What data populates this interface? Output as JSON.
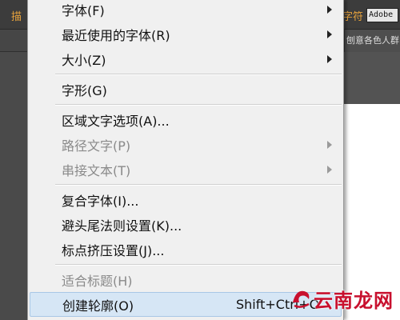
{
  "toolbar": {
    "left_text": "描",
    "right_text": "字符",
    "font_value": "Adobe"
  },
  "document_tab": "刨意各色人群",
  "menu": {
    "items": [
      {
        "label": "字体(F)",
        "submenu": true,
        "disabled": false
      },
      {
        "label": "最近使用的字体(R)",
        "submenu": true,
        "disabled": false
      },
      {
        "label": "大小(Z)",
        "submenu": true,
        "disabled": false
      },
      {
        "label": "字形(G)",
        "submenu": false,
        "disabled": false
      },
      {
        "label": "区域文字选项(A)...",
        "submenu": false,
        "disabled": false
      },
      {
        "label": "路径文字(P)",
        "submenu": true,
        "disabled": true
      },
      {
        "label": "串接文本(T)",
        "submenu": true,
        "disabled": true
      },
      {
        "label": "复合字体(I)...",
        "submenu": false,
        "disabled": false
      },
      {
        "label": "避头尾法则设置(K)...",
        "submenu": false,
        "disabled": false
      },
      {
        "label": "标点挤压设置(J)...",
        "submenu": false,
        "disabled": false
      },
      {
        "label": "适合标题(H)",
        "submenu": false,
        "disabled": true
      },
      {
        "label": "创建轮廓(O)",
        "shortcut": "Shift+Ctrl+O",
        "submenu": false,
        "disabled": false,
        "highlighted": true
      }
    ]
  },
  "watermark": {
    "text": "云南龙网"
  },
  "colors": {
    "menu_bg": "#f0f0f0",
    "highlight_bg": "#d6e6f5",
    "toolbar_accent": "#e8a33c",
    "watermark_red": "#c8102e"
  }
}
